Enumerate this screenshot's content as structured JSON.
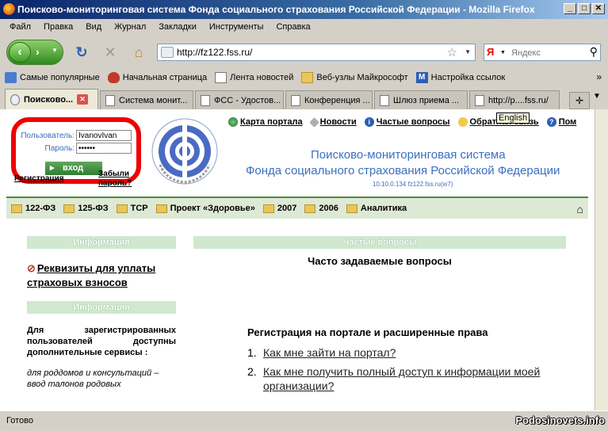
{
  "window": {
    "title": "Поисково-мониторинговая система Фонда социального страхования Российской Федерации - Mozilla Firefox"
  },
  "menu": [
    "Файл",
    "Правка",
    "Вид",
    "Журнал",
    "Закладки",
    "Инструменты",
    "Справка"
  ],
  "nav": {
    "url": "http://fz122.fss.ru/",
    "search_engine": "Я",
    "search_placeholder": "Яндекс"
  },
  "bookmarks": [
    "Самые популярные",
    "Начальная страница",
    "Лента новостей",
    "Веб-узлы Майкрософт",
    "Настройка ссылок"
  ],
  "bookmarks_more": "»",
  "tabs": [
    "Поисково...",
    "Система монит...",
    "ФСС - Удостов...",
    "Конференция ...",
    "Шлюз приема ...",
    "http://p....fss.ru/"
  ],
  "login": {
    "user_label": "Пользователь:",
    "user_value": "IvanovIvan",
    "pass_label": "Пароль:",
    "pass_value": "••••••",
    "submit": "вход",
    "register": "Регистрация",
    "forgot": "Забыли пароль?"
  },
  "toplinks": [
    "Карта портала",
    "Новости",
    "Частые вопросы",
    "Обратная связь",
    "Пом"
  ],
  "tooltip": "English",
  "site": {
    "title_line1": "Поисково-мониторинговая система",
    "title_line2": "Фонда социального страхования Российской Федерации",
    "version": "10.10.0.134  fz122.fss.ru(w7)"
  },
  "categories": [
    "122-ФЗ",
    "125-ФЗ",
    "ТСР",
    "Проект «Здоровье»",
    "2007",
    "2006",
    "Аналитика"
  ],
  "left": {
    "info_header_1": "Информация",
    "rekvizity": "Реквизиты для уплаты страховых взносов",
    "info_header_2": "Информация",
    "para1": "Для зарегистрированных пользователей доступны дополнительные сервисы :",
    "para2": "для роддомов и консультаций – ввод талонов родовых"
  },
  "faq": {
    "header": "Частые вопросы",
    "title": "Часто задаваемые вопросы",
    "section": "Регистрация на портале и расширенные права",
    "items": [
      "Как мне зайти на портал?",
      "Как мне получить полный доступ к информации моей организации?"
    ]
  },
  "status": {
    "text": "Готово",
    "watermark": "Podosinovets.info"
  }
}
